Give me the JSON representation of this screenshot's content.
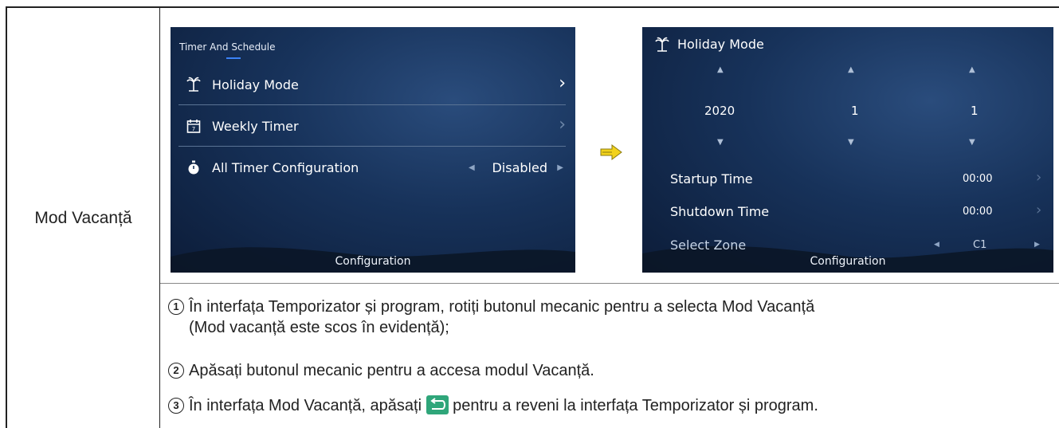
{
  "row_label": "Mod Vacanță",
  "screen1": {
    "title": "Timer And Schedule",
    "items": [
      {
        "label": "Holiday Mode",
        "icon": "palm-tree-icon"
      },
      {
        "label": "Weekly Timer",
        "icon": "calendar-icon"
      },
      {
        "label": "All Timer Configuration",
        "icon": "stopwatch-icon",
        "value": "Disabled"
      }
    ],
    "footer": "Configuration"
  },
  "screen2": {
    "title": "Holiday Mode",
    "date": {
      "year": "2020",
      "month": "1",
      "day": "1"
    },
    "rows": [
      {
        "label": "Startup Time",
        "value": "00:00"
      },
      {
        "label": "Shutdown Time",
        "value": "00:00"
      },
      {
        "label": "Select Zone",
        "value": "C1"
      }
    ],
    "footer": "Configuration"
  },
  "instructions": {
    "step1_line1": "În interfața Temporizator și program, rotiți butonul mecanic pentru a selecta Mod Vacanță",
    "step1_line2": "(Mod vacanță este scos în evidență);",
    "step2": "Apăsați butonul mecanic pentru a accesa modul Vacanță.",
    "step3_a": "În interfața Mod Vacanță, apăsați",
    "step3_b": "pentru a reveni la interfața Temporizator și program."
  },
  "colors": {
    "accent": "#3b82f6",
    "arrow": "#f2d21b",
    "back_icon": "#2fa67a"
  }
}
